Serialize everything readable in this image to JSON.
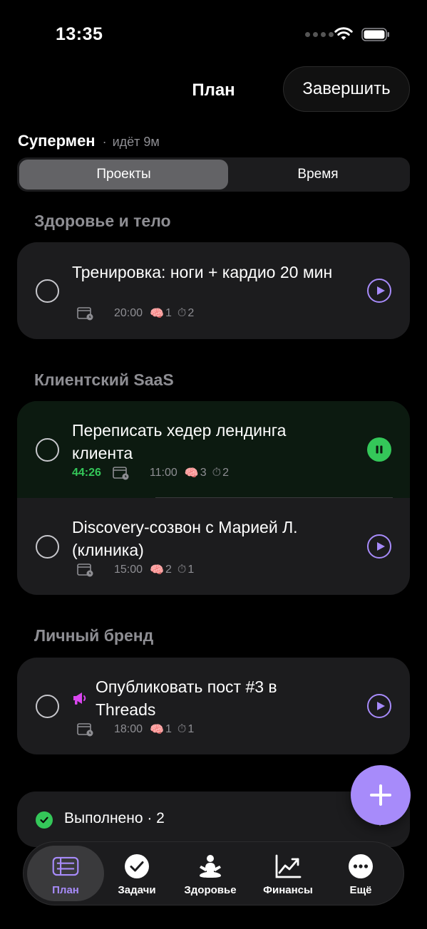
{
  "status_bar": {
    "time": "13:35",
    "icons": [
      "signal-dots-icon",
      "wifi-icon",
      "battery-icon"
    ]
  },
  "header": {
    "title": "План",
    "finish_label": "Завершить"
  },
  "session": {
    "name": "Супермен",
    "separator": "·",
    "status": "идёт 9м"
  },
  "segmented": {
    "options": [
      "Проекты",
      "Время"
    ],
    "selected": "Проекты"
  },
  "sections": [
    {
      "title": "Здоровье и тело",
      "tasks": [
        {
          "title": "Тренировка: ноги + кардио 20 мин",
          "time": "20:00",
          "brain": "1",
          "stopwatch": "2",
          "state": "play"
        }
      ]
    },
    {
      "title": "Клиентский SaaS",
      "tasks": [
        {
          "title": "Переписать хедер лендинга клиента",
          "timer": "44:26",
          "time": "11:00",
          "brain": "3",
          "stopwatch": "2",
          "state": "running"
        },
        {
          "title": "Discovery-созвон с Марией Л. (клиника)",
          "time": "15:00",
          "brain": "2",
          "stopwatch": "1",
          "state": "play"
        }
      ]
    },
    {
      "title": "Личный бренд",
      "tasks": [
        {
          "title": "Опубликовать пост #3 в Threads",
          "time": "18:00",
          "brain": "1",
          "stopwatch": "1",
          "state": "play",
          "icon": "megaphone-icon"
        }
      ]
    }
  ],
  "done": {
    "label": "Выполнено · 2"
  },
  "tabs": [
    {
      "label": "План",
      "icon": "plan-icon",
      "active": true
    },
    {
      "label": "Задачи",
      "icon": "check-circle-icon",
      "active": false
    },
    {
      "label": "Здоровье",
      "icon": "meditation-icon",
      "active": false
    },
    {
      "label": "Финансы",
      "icon": "chart-icon",
      "active": false
    },
    {
      "label": "Ещё",
      "icon": "more-icon",
      "active": false
    }
  ],
  "colors": {
    "accent": "#a78bfa",
    "running": "#34c759",
    "card": "#1c1c1e",
    "muted": "#8e8e93",
    "megaphone": "#d946ef"
  }
}
